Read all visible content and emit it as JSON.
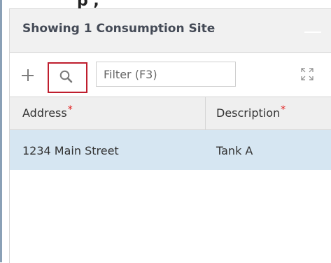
{
  "window": {
    "partial_top_text": "p ,"
  },
  "panel": {
    "title": "Showing 1 Consumption Site"
  },
  "toolbar": {
    "add_icon": "plus-icon",
    "search_icon": "search-icon",
    "filter_placeholder": "Filter (F3)",
    "expand_icon": "expand-icon",
    "highlight_color": "#bf1e2e"
  },
  "grid": {
    "columns": [
      {
        "label": "Address",
        "required": true
      },
      {
        "label": "Description",
        "required": true
      }
    ],
    "required_marker": "*",
    "rows": [
      {
        "address": "1234 Main Street",
        "description": "Tank A",
        "selected": true
      }
    ]
  },
  "colors": {
    "selected_row": "#d6e6f2",
    "required_marker": "#e21b1b"
  }
}
